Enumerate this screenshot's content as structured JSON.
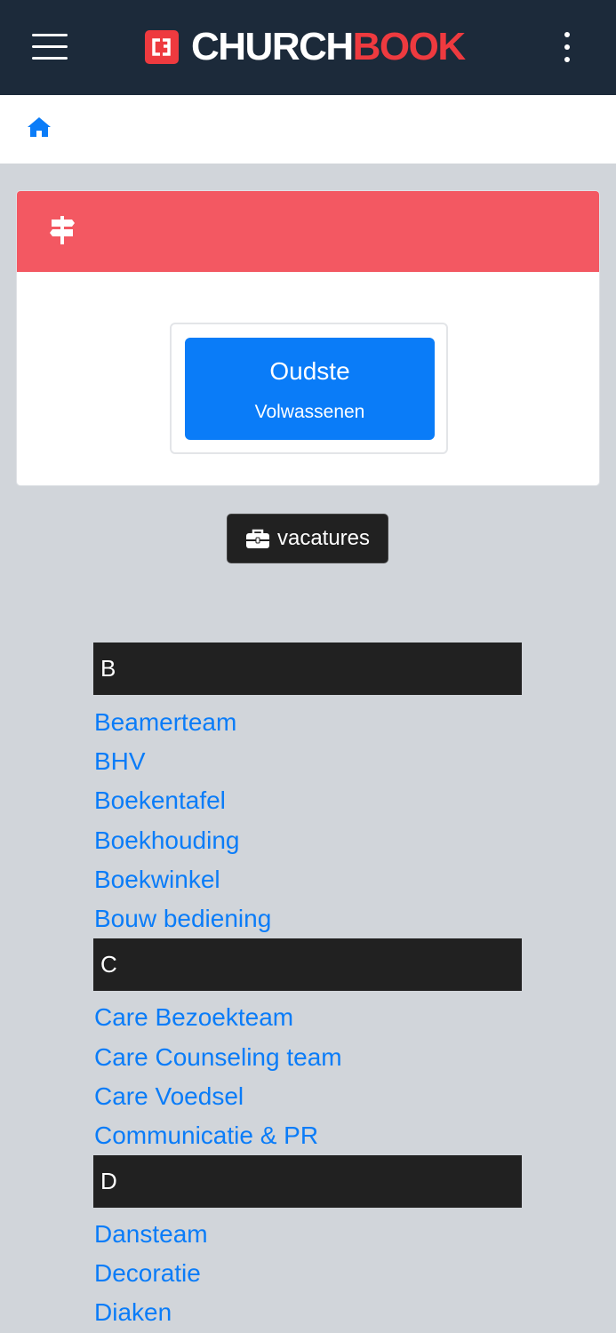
{
  "header": {
    "logo_text_white": "CHURCH",
    "logo_text_red": "BOOK",
    "menu_icon": "hamburger-icon",
    "more_icon": "vertical-dots-icon",
    "background": "#1c2a3a",
    "accent": "#ee3a3f"
  },
  "breadcrumb": {
    "home_icon": "home-icon"
  },
  "role_card": {
    "header_icon": "signpost-icon",
    "header_color": "#f35862",
    "role_title": "Oudste",
    "role_subtitle": "Volwassenen",
    "button_color": "#0a7cf8"
  },
  "vacatures_button": {
    "label": "vacatures",
    "icon": "briefcase-icon"
  },
  "groups": [
    {
      "letter": "B",
      "items": [
        "Beamerteam",
        "BHV",
        "Boekentafel",
        "Boekhouding",
        "Boekwinkel",
        "Bouw bediening"
      ]
    },
    {
      "letter": "C",
      "items": [
        "Care Bezoekteam",
        "Care Counseling team",
        "Care Voedsel",
        "Communicatie & PR"
      ]
    },
    {
      "letter": "D",
      "items": [
        "Dansteam",
        "Decoratie",
        "Diaken"
      ]
    }
  ]
}
